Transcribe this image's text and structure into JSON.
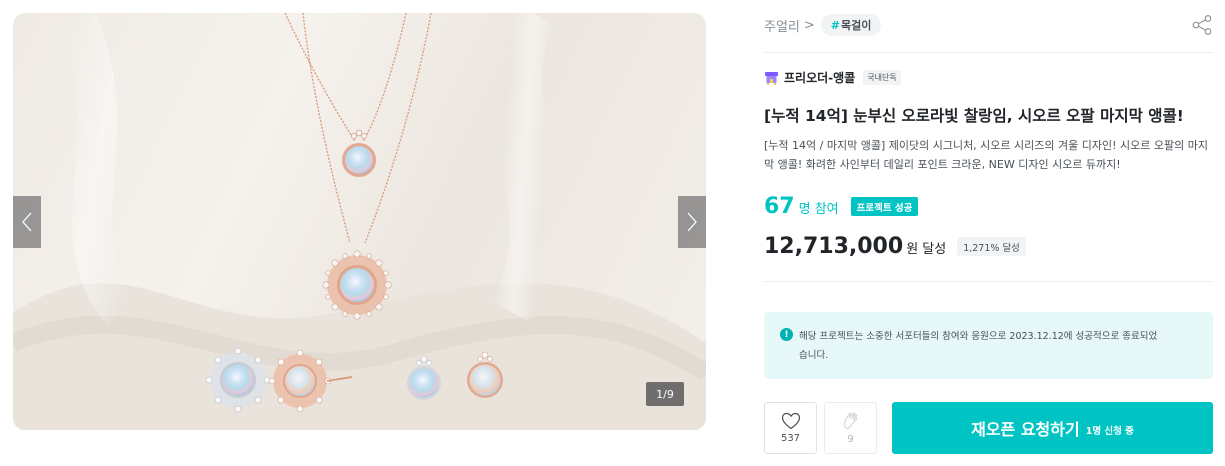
{
  "gallery": {
    "counter": "1/9",
    "prev_icon": "chevron-left-icon",
    "next_icon": "chevron-right-icon"
  },
  "breadcrumb": {
    "category": "주얼리",
    "separator": ">",
    "tag_hash": "#",
    "tag": "목걸이"
  },
  "share_icon": "share-icon",
  "maker": {
    "icon": "store-icon",
    "name": "프리오더-앵콜",
    "badge": "국내단독"
  },
  "project": {
    "title": "[누적 14억] 눈부신 오로라빛 찰랑임, 시오르 오팔 마지막 앵콜!",
    "description": "[누적 14억 / 마지막 앵콜] 제이닷의 시그니처, 시오르 시리즈의 겨울 디자인! 시오르 오팔의 마지막 앵콜! 화려한 사인부터 데일리 포인트 크라운, NEW 디자인 시오르 듀까지!"
  },
  "stats": {
    "participants": "67",
    "participants_unit": "명 참여",
    "success_badge": "프로젝트 성공",
    "amount": "12,713,000",
    "amount_unit": "원 달성",
    "achievement": "1,271% 달성"
  },
  "notice": {
    "icon": "info-icon",
    "icon_glyph": "!",
    "text": "해당 프로젝트는 소중한 서포터들의 참여와 응원으로 2023.12.12에 성공적으로 종료되었습니다."
  },
  "actions": {
    "like_icon": "heart-icon",
    "like_count": "537",
    "clap_icon": "clap-icon",
    "clap_count": "9",
    "reopen_label": "재오픈 요청하기",
    "reopen_sub": "1명 신청 중"
  },
  "colors": {
    "accent": "#00c4c4",
    "notice_bg": "#e6f8f8"
  }
}
